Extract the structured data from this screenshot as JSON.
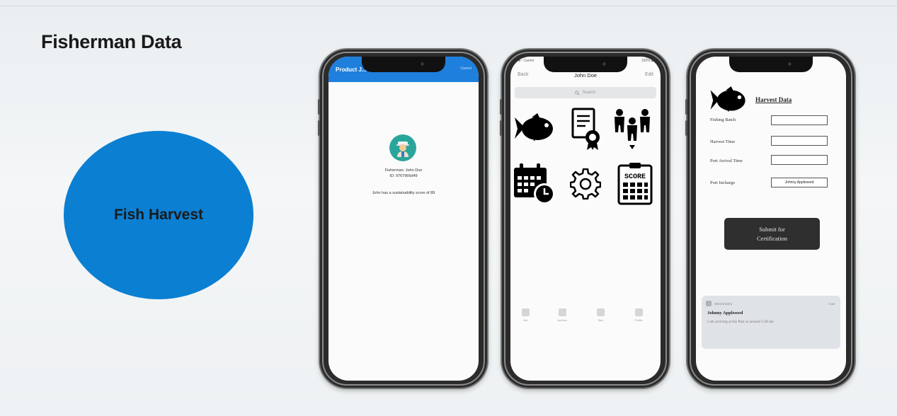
{
  "slide": {
    "title": "Fisherman Data",
    "ellipse_label": "Fish Harvest",
    "ellipse_color": "#0b7fd2"
  },
  "phone_profile": {
    "header_title": "Product J...",
    "header_right": "Cancel",
    "header_color": "#1e7fdc",
    "avatar_icon": "fisherman-avatar-icon",
    "name_line": "Fisherman: John Doe",
    "id_line": "ID: 9767966d49",
    "score_line": "John has a sustainability score of 89"
  },
  "phone_menu": {
    "status_left": "●●○ Carrier",
    "status_right": "100% ▬",
    "back_label": "Back",
    "title": "John Doe",
    "edit_label": "Edit",
    "search_placeholder": "Search",
    "tiles": [
      "fish-icon",
      "certificate-icon",
      "crew-icon",
      "calendar-clock-icon",
      "gear-icon",
      "scoreboard-icon"
    ],
    "tabs": [
      "Dot",
      "Archive",
      "Stat",
      "Profile"
    ]
  },
  "phone_form": {
    "heading": "Harvest Data",
    "fields": [
      {
        "label": "Fishing Batch",
        "value": ""
      },
      {
        "label": "Harvest Time",
        "value": ""
      },
      {
        "label": "Port Arrival Time",
        "value": ""
      },
      {
        "label": "Port Incharge",
        "value": "Johnny Appleseed"
      }
    ],
    "submit_line1": "Submit for",
    "submit_line2": "Certification",
    "notification": {
      "app": "MESSAGES",
      "time": "now",
      "sender": "Johnny Appleseed",
      "message": "I am arriving at the Port at around 5:30 am"
    }
  }
}
